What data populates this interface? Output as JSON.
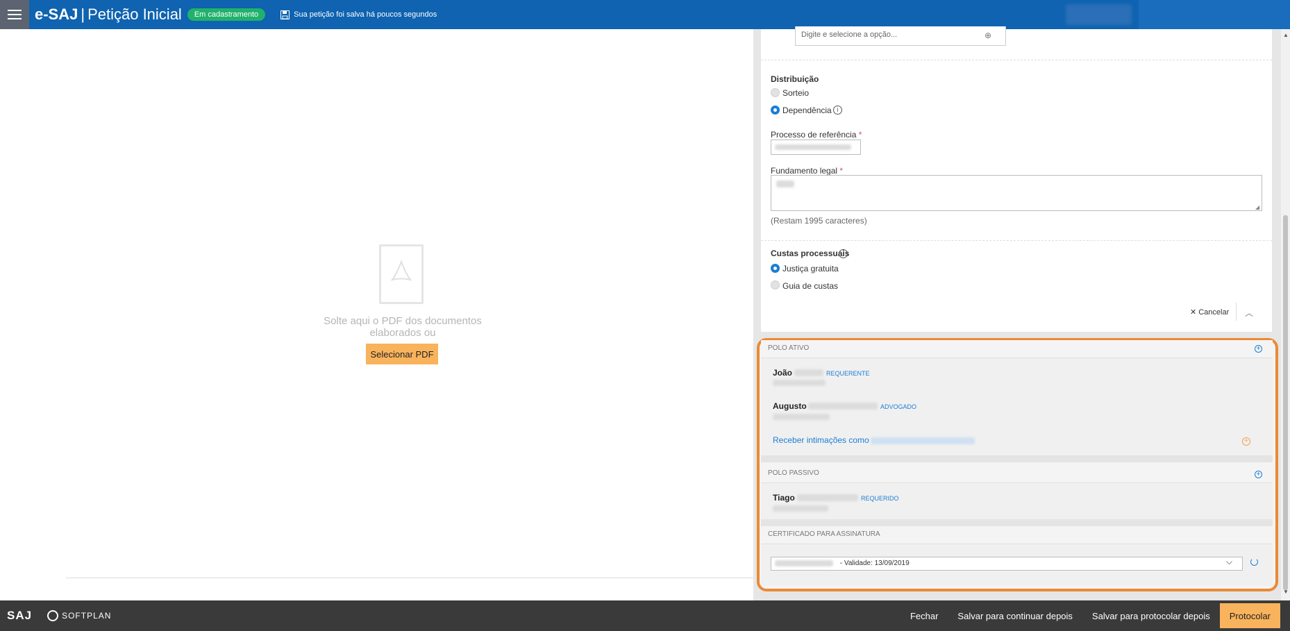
{
  "header": {
    "app_name": "e-SAJ",
    "separator": "|",
    "page_title": "Petição Inicial",
    "status": "Em cadastramento",
    "save_message": "Sua petição foi salva há poucos segundos"
  },
  "left": {
    "drop_text_line1": "Solte aqui o PDF dos documentos",
    "drop_text_line2": "elaborados ou",
    "select_pdf": "Selecionar PDF"
  },
  "form": {
    "option_placeholder": "Digite e selecione a opção...",
    "distribuicao_label": "Distribuição",
    "sorteio": "Sorteio",
    "dependencia": "Dependência",
    "processo_label": "Processo de referência",
    "fundamento_label": "Fundamento legal",
    "required_mark": "*",
    "chars_left": "(Restam 1995 caracteres)",
    "custas_label": "Custas processuais",
    "justica_gratuita": "Justiça gratuita",
    "guia_custas": "Guia de custas",
    "cancel": "Cancelar"
  },
  "polo_ativo": {
    "title": "POLO ATIVO",
    "parties": [
      {
        "name": "João",
        "role": "REQUERENTE"
      },
      {
        "name": "Augusto",
        "role": "ADVOGADO"
      }
    ],
    "intimacoes_link": "Receber intimações como"
  },
  "polo_passivo": {
    "title": "POLO PASSIVO",
    "parties": [
      {
        "name": "Tiago",
        "role": "REQUERIDO"
      }
    ]
  },
  "certificado": {
    "title": "CERTIFICADO PARA ASSINATURA",
    "validity": "- Validade: 13/09/2019"
  },
  "footer": {
    "logo": "SAJ",
    "brand": "SOFTPLAN",
    "fechar": "Fechar",
    "salvar_continuar": "Salvar para continuar depois",
    "salvar_protocolar": "Salvar para protocolar depois",
    "protocolar": "Protocolar"
  },
  "colors": {
    "header_blue": "#0f63b0",
    "status_green": "#21b16b",
    "accent_orange": "#f8b35c",
    "highlight_border": "#ea8a35",
    "link_blue": "#1a7ed4",
    "footer_dark": "#3a3a3a"
  }
}
